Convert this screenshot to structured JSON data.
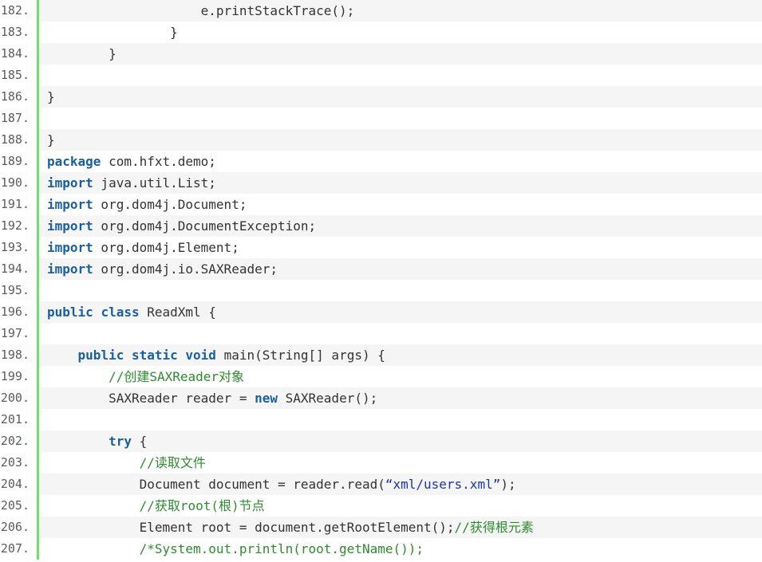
{
  "lines": [
    {
      "num": "182.",
      "indent": "                    ",
      "tokens": [
        {
          "t": "plain",
          "v": "e.printStackTrace();"
        }
      ]
    },
    {
      "num": "183.",
      "indent": "                ",
      "tokens": [
        {
          "t": "plain",
          "v": "}"
        }
      ]
    },
    {
      "num": "184.",
      "indent": "        ",
      "tokens": [
        {
          "t": "plain",
          "v": "}"
        }
      ]
    },
    {
      "num": "185.",
      "indent": "",
      "tokens": []
    },
    {
      "num": "186.",
      "indent": "",
      "tokens": [
        {
          "t": "plain",
          "v": "}"
        }
      ]
    },
    {
      "num": "187.",
      "indent": "",
      "tokens": []
    },
    {
      "num": "188.",
      "indent": "",
      "tokens": [
        {
          "t": "plain",
          "v": "}"
        }
      ]
    },
    {
      "num": "189.",
      "indent": "",
      "tokens": [
        {
          "t": "kw",
          "v": "package"
        },
        {
          "t": "plain",
          "v": " com.hfxt.demo;"
        }
      ]
    },
    {
      "num": "190.",
      "indent": "",
      "tokens": [
        {
          "t": "kw",
          "v": "import"
        },
        {
          "t": "plain",
          "v": " java.util.List;"
        }
      ]
    },
    {
      "num": "191.",
      "indent": "",
      "tokens": [
        {
          "t": "kw",
          "v": "import"
        },
        {
          "t": "plain",
          "v": " org.dom4j.Document;"
        }
      ]
    },
    {
      "num": "192.",
      "indent": "",
      "tokens": [
        {
          "t": "kw",
          "v": "import"
        },
        {
          "t": "plain",
          "v": " org.dom4j.DocumentException;"
        }
      ]
    },
    {
      "num": "193.",
      "indent": "",
      "tokens": [
        {
          "t": "kw",
          "v": "import"
        },
        {
          "t": "plain",
          "v": " org.dom4j.Element;"
        }
      ]
    },
    {
      "num": "194.",
      "indent": "",
      "tokens": [
        {
          "t": "kw",
          "v": "import"
        },
        {
          "t": "plain",
          "v": " org.dom4j.io.SAXReader;"
        }
      ]
    },
    {
      "num": "195.",
      "indent": "",
      "tokens": []
    },
    {
      "num": "196.",
      "indent": "",
      "tokens": [
        {
          "t": "kw",
          "v": "public"
        },
        {
          "t": "plain",
          "v": " "
        },
        {
          "t": "kw",
          "v": "class"
        },
        {
          "t": "plain",
          "v": " ReadXml {"
        }
      ]
    },
    {
      "num": "197.",
      "indent": "",
      "tokens": []
    },
    {
      "num": "198.",
      "indent": "    ",
      "tokens": [
        {
          "t": "kw",
          "v": "public"
        },
        {
          "t": "plain",
          "v": " "
        },
        {
          "t": "kw",
          "v": "static"
        },
        {
          "t": "plain",
          "v": " "
        },
        {
          "t": "kw",
          "v": "void"
        },
        {
          "t": "plain",
          "v": " main(String[] args) {"
        }
      ]
    },
    {
      "num": "199.",
      "indent": "        ",
      "tokens": [
        {
          "t": "comment",
          "v": "//创建SAXReader对象"
        }
      ]
    },
    {
      "num": "200.",
      "indent": "        ",
      "tokens": [
        {
          "t": "plain",
          "v": "SAXReader reader = "
        },
        {
          "t": "kw",
          "v": "new"
        },
        {
          "t": "plain",
          "v": " SAXReader();"
        }
      ]
    },
    {
      "num": "201.",
      "indent": "",
      "tokens": []
    },
    {
      "num": "202.",
      "indent": "        ",
      "tokens": [
        {
          "t": "kw",
          "v": "try"
        },
        {
          "t": "plain",
          "v": " {"
        }
      ]
    },
    {
      "num": "203.",
      "indent": "            ",
      "tokens": [
        {
          "t": "comment",
          "v": "//读取文件"
        }
      ]
    },
    {
      "num": "204.",
      "indent": "            ",
      "tokens": [
        {
          "t": "plain",
          "v": "Document document = reader.read("
        },
        {
          "t": "str",
          "v": "“xml/users.xml”"
        },
        {
          "t": "plain",
          "v": ");"
        }
      ]
    },
    {
      "num": "205.",
      "indent": "            ",
      "tokens": [
        {
          "t": "comment",
          "v": "//获取root(根)节点"
        }
      ]
    },
    {
      "num": "206.",
      "indent": "            ",
      "tokens": [
        {
          "t": "plain",
          "v": "Element root = document.getRootElement();"
        },
        {
          "t": "comment",
          "v": "//获得根元素"
        }
      ]
    },
    {
      "num": "207.",
      "indent": "            ",
      "tokens": [
        {
          "t": "comment",
          "v": "/*System.out.println(root.getName());"
        }
      ]
    }
  ]
}
